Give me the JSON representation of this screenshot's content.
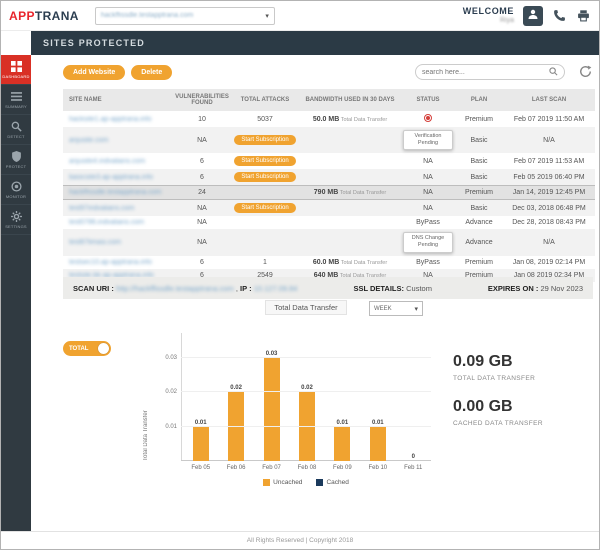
{
  "header": {
    "logo_app": "APP",
    "logo_trana": "TRANA",
    "domain": "hackffissdle.testapptrana.com",
    "welcome": "WELCOME",
    "username": "Riya"
  },
  "title_bar": "SITES PROTECTED",
  "sidebar": {
    "items": [
      {
        "label": "DASHBOARD",
        "icon": "dashboard",
        "active": true
      },
      {
        "label": "SUMMARY",
        "icon": "summary",
        "active": false
      },
      {
        "label": "DETECT",
        "icon": "detect",
        "active": false
      },
      {
        "label": "PROTECT",
        "icon": "protect",
        "active": false
      },
      {
        "label": "MONITOR",
        "icon": "monitor",
        "active": false
      },
      {
        "label": "SETTINGS",
        "icon": "settings",
        "active": false
      }
    ]
  },
  "toolbar": {
    "add_website": "Add Website",
    "delete": "Delete",
    "search_placeholder": "search here..."
  },
  "table": {
    "headers": [
      "SITE NAME",
      "VULNERABILITIES FOUND",
      "TOTAL ATTACKS",
      "BANDWIDTH USED IN 30 DAYS",
      "STATUS",
      "PLAN",
      "LAST SCAN"
    ],
    "start_subscription_label": "Start Subscription",
    "bandwidth_suffix": "Total Data Transfer",
    "rows": [
      {
        "site": "hacksite1.ap-apptrana.info",
        "vuln": "10",
        "attacks": "5037",
        "attacks_is_button": false,
        "bandwidth": "50.0 MB",
        "status": "",
        "status_type": "icon",
        "plan": "Premium",
        "last_scan": "Feb 07 2019 11:50 AM",
        "highlight": false
      },
      {
        "site": "anjusite.com",
        "vuln": "NA",
        "attacks": "",
        "attacks_is_button": true,
        "bandwidth": "",
        "status": "Verification Pending",
        "status_type": "callout",
        "plan": "Basic",
        "last_scan": "N/A",
        "highlight": false
      },
      {
        "site": "anjusite4.indvalians.com",
        "vuln": "6",
        "attacks": "",
        "attacks_is_button": true,
        "bandwidth": "",
        "status": "NA",
        "status_type": "text",
        "plan": "Basic",
        "last_scan": "Feb 07 2019 11:53 AM",
        "highlight": false
      },
      {
        "site": "basicsite3.ap-apptrana.info",
        "vuln": "6",
        "attacks": "",
        "attacks_is_button": true,
        "bandwidth": "",
        "status": "NA",
        "status_type": "text",
        "plan": "Basic",
        "last_scan": "Feb 05 2019 06:40 PM",
        "highlight": false
      },
      {
        "site": "hackffissdle.testapptrana.com",
        "vuln": "24",
        "attacks": "",
        "attacks_is_button": false,
        "bandwidth": "790 MB",
        "status": "NA",
        "status_type": "text",
        "plan": "Premium",
        "last_scan": "Jan 14, 2019 12:45 PM",
        "highlight": true
      },
      {
        "site": "test97indvalians.com",
        "vuln": "NA",
        "attacks": "",
        "attacks_is_button": true,
        "bandwidth": "",
        "status": "NA",
        "status_type": "text",
        "plan": "Basic",
        "last_scan": "Dec 03, 2018 06:48 PM",
        "highlight": false
      },
      {
        "site": "test0786.indvalians.com",
        "vuln": "NA",
        "attacks": "",
        "attacks_is_button": false,
        "bandwidth": "",
        "status": "ByPass",
        "status_type": "text",
        "plan": "Advance",
        "last_scan": "Dec 28, 2018 08:43 PM",
        "highlight": false
      },
      {
        "site": "test87limasi.com",
        "vuln": "NA",
        "attacks": "",
        "attacks_is_button": false,
        "bandwidth": "",
        "status": "DNS Change Pending",
        "status_type": "callout",
        "plan": "Advance",
        "last_scan": "N/A",
        "highlight": false
      },
      {
        "site": "testsec10.ap-apptrana.info",
        "vuln": "6",
        "attacks": "1",
        "attacks_is_button": false,
        "bandwidth": "60.0 MB",
        "status": "ByPass",
        "status_type": "text",
        "plan": "Premium",
        "last_scan": "Jan 08, 2019 02:14 PM",
        "highlight": false
      },
      {
        "site": "testsite.bk-ap-apptrana.info",
        "vuln": "6",
        "attacks": "2549",
        "attacks_is_button": false,
        "bandwidth": "640 MB",
        "status": "NA",
        "status_type": "text",
        "plan": "Premium",
        "last_scan": "Jan 08 2019 02:34 PM",
        "highlight": false
      }
    ]
  },
  "scan_info": {
    "scan_uri_label": "SCAN URI :",
    "scan_uri": "http://hackffissdle.testapptrana.com",
    "comma": ", ",
    "ip_label": "IP :",
    "ip": "10.127.09.84",
    "ssl_label": "SSL DETAILS:",
    "ssl_value": "Custom",
    "expires_label": "EXPIRES ON :",
    "expires_value": "29 Nov 2023"
  },
  "chart_data": {
    "type": "bar",
    "title": "Total Data Transfer",
    "period_selector": "WEEK",
    "toggle_label": "TOTAL",
    "x": [
      "Feb 05",
      "Feb 06",
      "Feb 07",
      "Feb 08",
      "Feb 09",
      "Feb 10",
      "Feb 11"
    ],
    "series": [
      {
        "name": "Uncached",
        "color": "#f0a330",
        "values": [
          0.01,
          0.02,
          0.03,
          0.02,
          0.01,
          0.01,
          0
        ]
      },
      {
        "name": "Cached",
        "color": "#1b3a5c",
        "values": [
          0,
          0,
          0,
          0,
          0,
          0,
          0
        ]
      }
    ],
    "ylabel": "Total Data Transfer",
    "yticks": [
      0.01,
      0.02,
      0.03
    ],
    "ylim": [
      0,
      0.035
    ],
    "legend_position": "bottom",
    "grid": true
  },
  "stats": {
    "total_value": "0.09 GB",
    "total_label": "TOTAL DATA TRANSFER",
    "cached_value": "0.00 GB",
    "cached_label": "CACHED DATA TRANSFER"
  },
  "footer": "All Rights Reserved | Copyright 2018"
}
